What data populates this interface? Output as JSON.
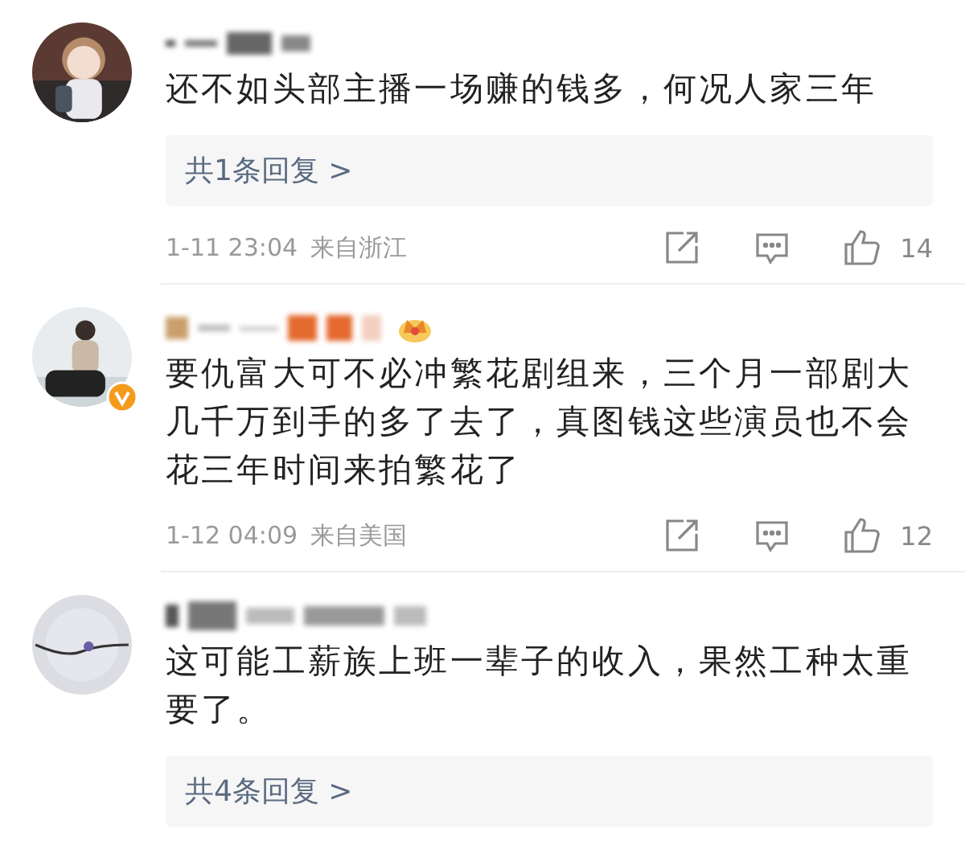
{
  "comments": [
    {
      "verified": false,
      "vip_crown": false,
      "text": "还不如头部主播一场赚的钱多，何况人家三年",
      "replies": "共1条回复 >",
      "time": "1-11 23:04",
      "location": "来自浙江",
      "likes": "14"
    },
    {
      "verified": true,
      "vip_crown": true,
      "text": "要仇富大可不必冲繁花剧组来，三个月一部剧大几千万到手的多了去了，真图钱这些演员也不会花三年时间来拍繁花了",
      "time": "1-12 04:09",
      "location": "来自美国",
      "likes": "12"
    },
    {
      "verified": false,
      "vip_crown": false,
      "text": "这可能工薪族上班一辈子的收入，果然工种太重要了。",
      "replies": "共4条回复 >"
    }
  ]
}
